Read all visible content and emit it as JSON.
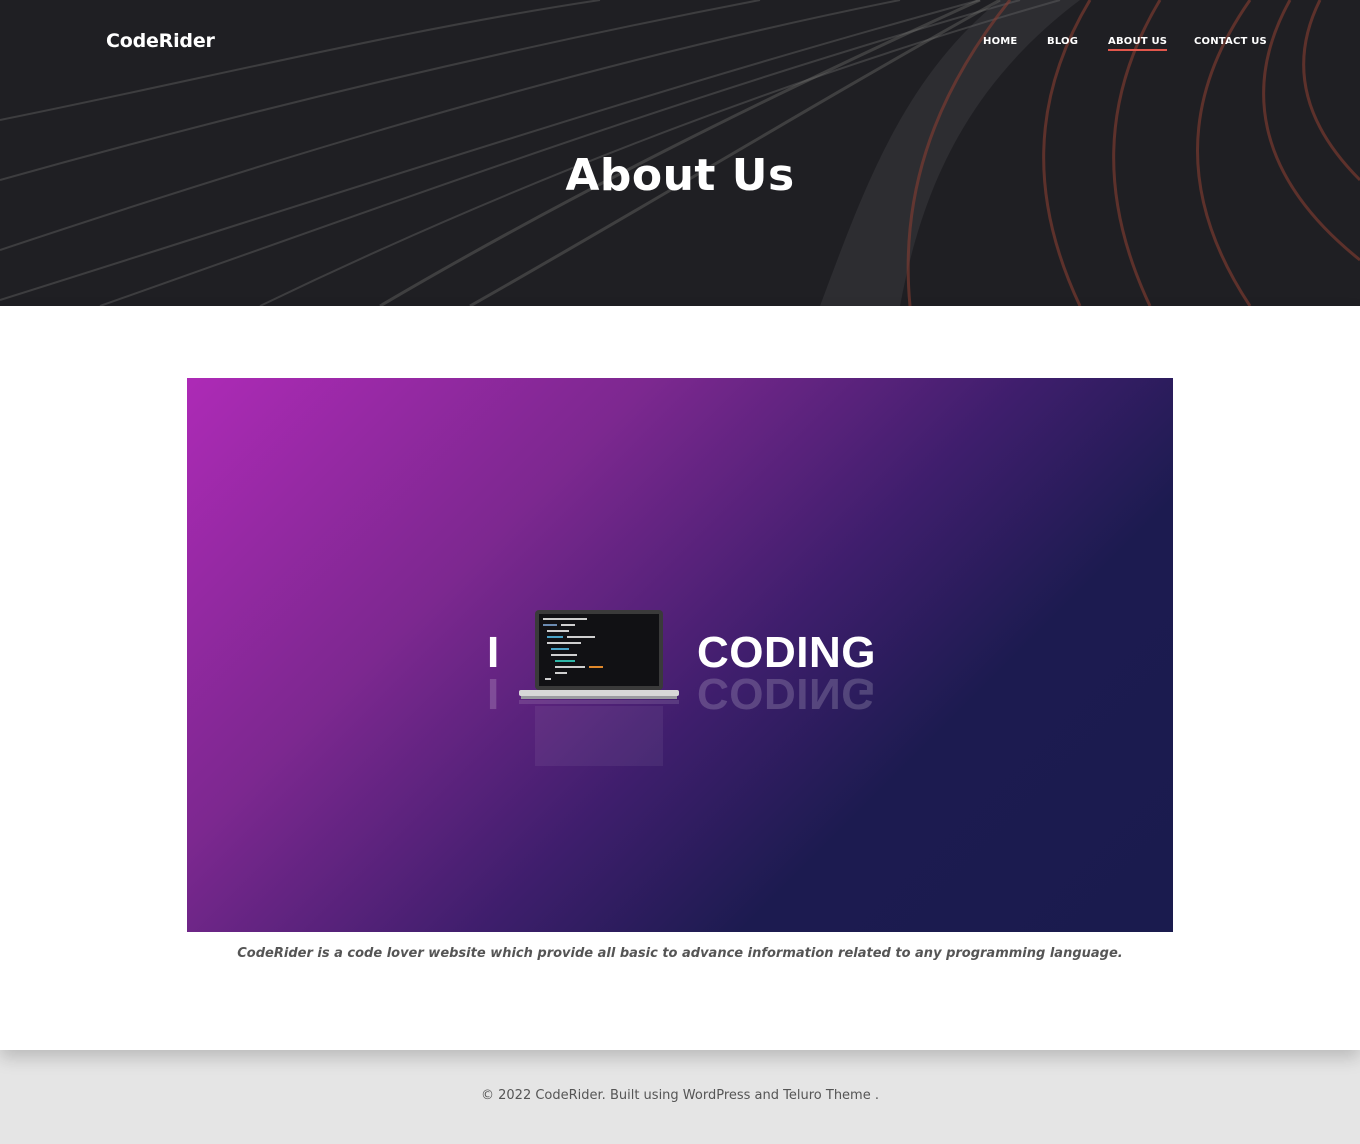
{
  "header": {
    "brand": "CodeRider",
    "nav": {
      "home": "HOME",
      "blog": "BLOG",
      "about": "ABOUT US",
      "contact": "CONTACT US"
    },
    "active_item": "ABOUT US",
    "active_underline_color": "#e2574c"
  },
  "hero": {
    "title": "About Us"
  },
  "feature_image": {
    "left_text": "I",
    "right_text": "CODING",
    "icon": "laptop-icon",
    "gradient_colors": [
      "#ad2ab6",
      "#1a1b4e"
    ]
  },
  "main": {
    "caption": "CodeRider is a code lover website which provide all basic to advance information related to any programming language."
  },
  "footer": {
    "text": "© 2022 CodeRider. Built using WordPress and Teluro Theme ."
  }
}
